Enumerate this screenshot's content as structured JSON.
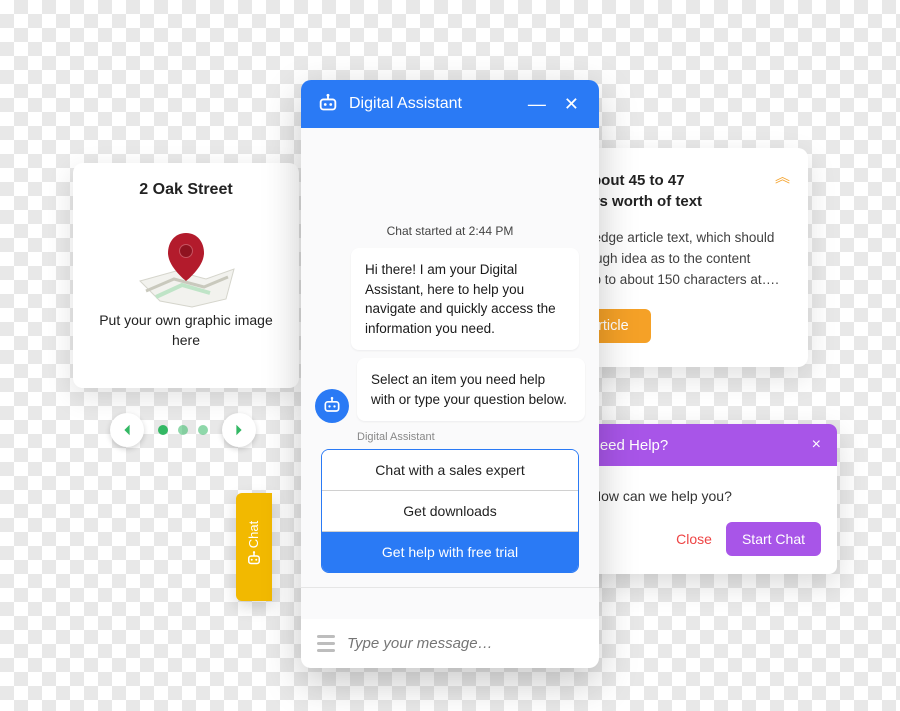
{
  "map_card": {
    "title": "2 Oak Street",
    "caption": "Put your own graphic image here"
  },
  "carousel": {
    "prev_name": "carousel-prev",
    "next_name": "carousel-next"
  },
  "chat_tab": {
    "label": "Chat"
  },
  "article": {
    "title": "This is about 45 to 47 characters worth of text",
    "body": "The knowledge article text, which should give the rough idea as to the content contains up to about 150 characters at….",
    "button": "View Article"
  },
  "help": {
    "header": "Need Help?",
    "body": "How can we help you?",
    "close": "Close",
    "start": "Start Chat"
  },
  "chat": {
    "header_title": "Digital Assistant",
    "started": "Chat started at 2:44 PM",
    "msg1": "Hi there! I am your Digital Assistant, here to help you navigate and quickly access the information you need.",
    "msg2": "Select an item you need help with or type your question below.",
    "sender": "Digital Assistant",
    "options": {
      "o1": "Chat with a sales expert",
      "o2": "Get downloads",
      "o3": "Get help with free trial"
    },
    "input_placeholder": "Type your message…"
  }
}
